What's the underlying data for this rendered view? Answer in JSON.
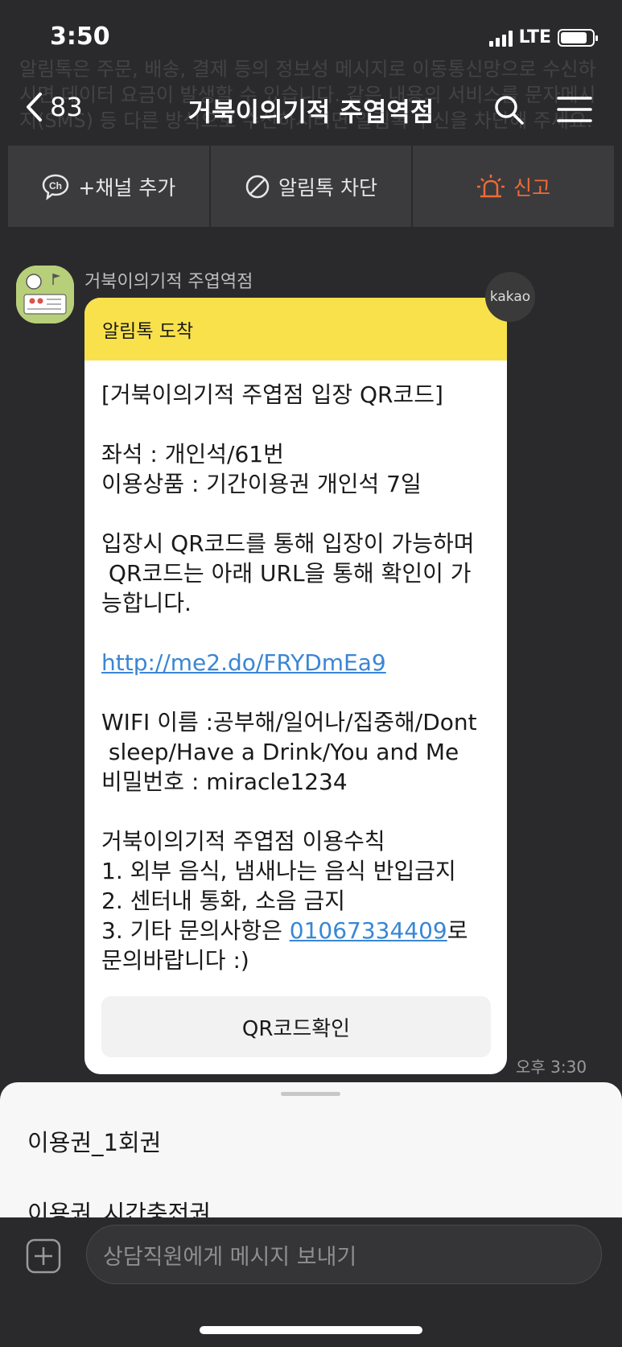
{
  "status": {
    "time": "3:50",
    "network": "LTE",
    "battery_level": 0.85
  },
  "background_notice": "알림톡은 주문, 배송, 결제 등의 정보성 메시지로 이동통신망으로 수신하시면 데이터 요금이 발생할 수 있습니다. 같은 내용의 서비스를 문자메시지(SMS) 등 다른 방식으로 수신하시려면 알림톡 수신을 차단해 주세요.",
  "header": {
    "back_count": "83",
    "title": "거북이의기적 주엽역점"
  },
  "actions": {
    "add_channel": "+채널 추가",
    "block": "알림톡 차단",
    "report": "신고"
  },
  "sender": {
    "name": "거북이의기적 주엽역점"
  },
  "badge": "kakao",
  "message": {
    "header": "알림톡 도착",
    "line1": "[거북이의기적 주엽점 입장 QR코드]",
    "seat": "좌석 : 개인석/61번",
    "product": "이용상품 : 기간이용권 개인석 7일",
    "entry1": "입장시 QR코드를 통해 입장이 가능하며",
    "entry2": " QR코드는 아래 URL을 통해 확인이 가",
    "entry3": "능합니다.",
    "url": "http://me2.do/FRYDmEa9",
    "wifi1": "WIFI 이름 :공부해/일어나/집중해/Dont",
    "wifi2": " sleep/Have a Drink/You and Me",
    "password": "비밀번호 : miracle1234",
    "rules_title": "거북이의기적 주엽점 이용수칙",
    "rule1": "1. 외부 음식, 냄새나는 음식 반입금지",
    "rule2": "2. 센터내 통화, 소음 금지",
    "rule3_prefix": "3. 기타 문의사항은 ",
    "phone": "01067334409",
    "rule3_suffix": "로",
    "rule3_end": "문의바랍니다 :)",
    "button": "QR코드확인",
    "time": "오후 3:30"
  },
  "sheet": {
    "items": [
      "이용권_1회권",
      "이용권_시간충전권"
    ]
  },
  "input": {
    "placeholder": "상담직원에게 메시지 보내기"
  },
  "colors": {
    "accent_yellow": "#f9e14b",
    "report_orange": "#f06a35",
    "link_blue": "#3a86d4"
  }
}
